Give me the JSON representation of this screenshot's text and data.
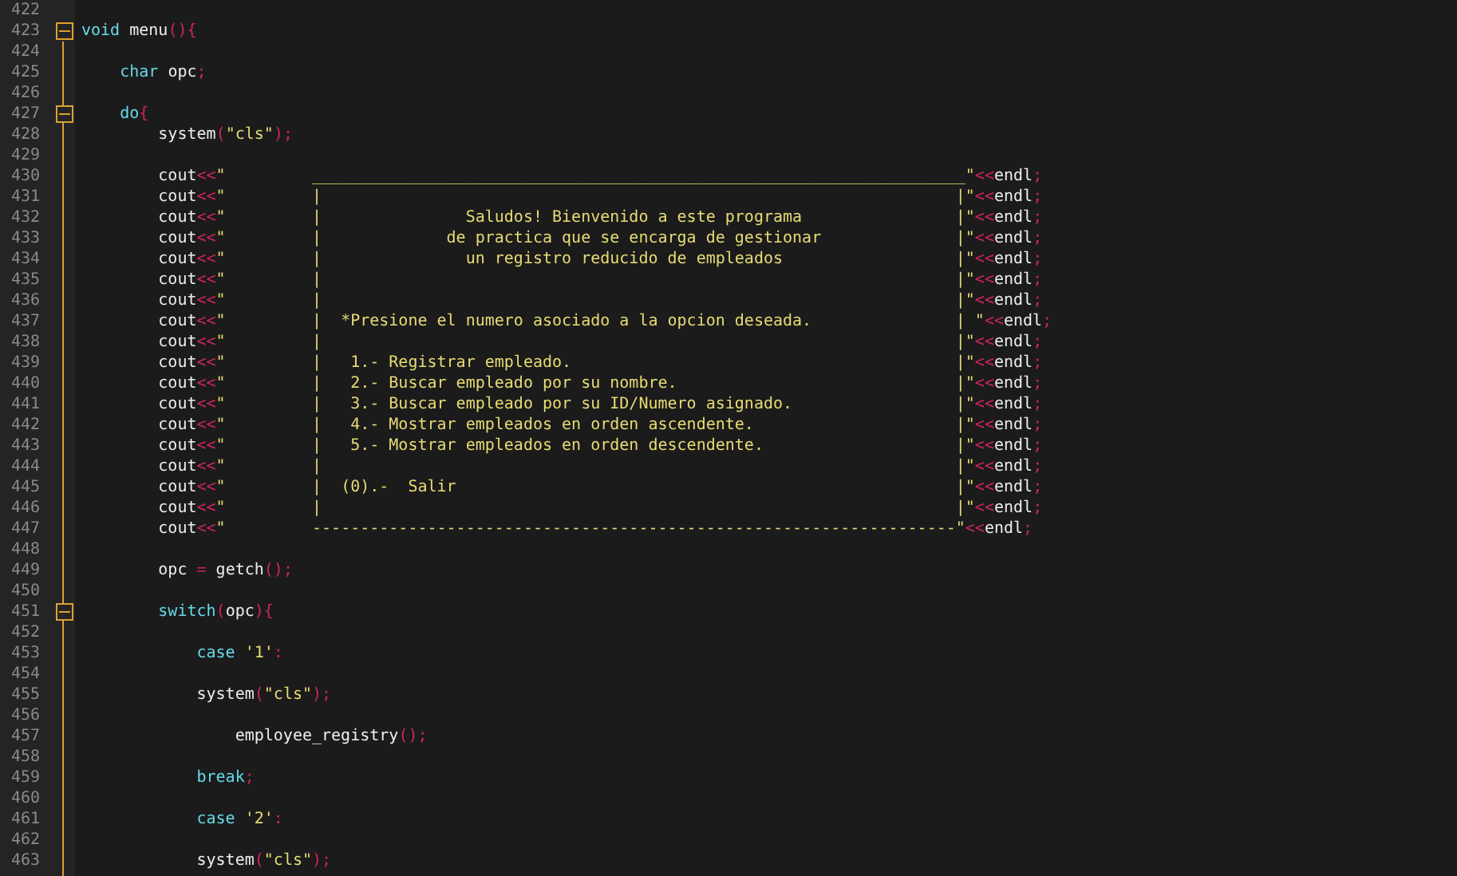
{
  "editor": {
    "lines": [
      {
        "number": "422",
        "fold_marker": false
      },
      {
        "number": "423",
        "fold_marker": true,
        "tokens": [
          {
            "kind": "keyword",
            "text": "void"
          },
          {
            "kind": "plain",
            "text": " menu"
          },
          {
            "kind": "punct",
            "text": "(){"
          }
        ]
      },
      {
        "number": "424",
        "fold_marker": false
      },
      {
        "number": "425",
        "fold_marker": false,
        "tokens": [
          {
            "kind": "keyword",
            "text": "    char"
          },
          {
            "kind": "plain",
            "text": " opc"
          },
          {
            "kind": "punct",
            "text": ";"
          }
        ]
      },
      {
        "number": "426",
        "fold_marker": false
      },
      {
        "number": "427",
        "fold_marker": true,
        "tokens": [
          {
            "kind": "keyword",
            "text": "    do"
          },
          {
            "kind": "punct",
            "text": "{"
          }
        ]
      },
      {
        "number": "428",
        "fold_marker": false,
        "tokens": [
          {
            "kind": "plain",
            "text": "        system"
          },
          {
            "kind": "punct",
            "text": "("
          },
          {
            "kind": "string",
            "text": "\"cls\""
          },
          {
            "kind": "punct",
            "text": ");"
          }
        ]
      },
      {
        "number": "429",
        "fold_marker": false
      },
      {
        "number": "430",
        "fold_marker": false,
        "tokens": [
          {
            "kind": "plain",
            "text": "        cout"
          },
          {
            "kind": "punct",
            "text": "<<"
          },
          {
            "kind": "string",
            "text": "\"         ____________________________________________________________________\""
          },
          {
            "kind": "punct",
            "text": "<<"
          },
          {
            "kind": "plain",
            "text": "endl"
          },
          {
            "kind": "punct",
            "text": ";"
          }
        ]
      },
      {
        "number": "431",
        "fold_marker": false,
        "tokens": [
          {
            "kind": "plain",
            "text": "        cout"
          },
          {
            "kind": "punct",
            "text": "<<"
          },
          {
            "kind": "string",
            "text": "\"         |                                                                  |\""
          },
          {
            "kind": "punct",
            "text": "<<"
          },
          {
            "kind": "plain",
            "text": "endl"
          },
          {
            "kind": "punct",
            "text": ";"
          }
        ]
      },
      {
        "number": "432",
        "fold_marker": false,
        "tokens": [
          {
            "kind": "plain",
            "text": "        cout"
          },
          {
            "kind": "punct",
            "text": "<<"
          },
          {
            "kind": "string",
            "text": "\"         |               Saludos! Bienvenido a este programa                |\""
          },
          {
            "kind": "punct",
            "text": "<<"
          },
          {
            "kind": "plain",
            "text": "endl"
          },
          {
            "kind": "punct",
            "text": ";"
          }
        ]
      },
      {
        "number": "433",
        "fold_marker": false,
        "tokens": [
          {
            "kind": "plain",
            "text": "        cout"
          },
          {
            "kind": "punct",
            "text": "<<"
          },
          {
            "kind": "string",
            "text": "\"         |             de practica que se encarga de gestionar              |\""
          },
          {
            "kind": "punct",
            "text": "<<"
          },
          {
            "kind": "plain",
            "text": "endl"
          },
          {
            "kind": "punct",
            "text": ";"
          }
        ]
      },
      {
        "number": "434",
        "fold_marker": false,
        "tokens": [
          {
            "kind": "plain",
            "text": "        cout"
          },
          {
            "kind": "punct",
            "text": "<<"
          },
          {
            "kind": "string",
            "text": "\"         |               un registro reducido de empleados                  |\""
          },
          {
            "kind": "punct",
            "text": "<<"
          },
          {
            "kind": "plain",
            "text": "endl"
          },
          {
            "kind": "punct",
            "text": ";"
          }
        ]
      },
      {
        "number": "435",
        "fold_marker": false,
        "tokens": [
          {
            "kind": "plain",
            "text": "        cout"
          },
          {
            "kind": "punct",
            "text": "<<"
          },
          {
            "kind": "string",
            "text": "\"         |                                                                  |\""
          },
          {
            "kind": "punct",
            "text": "<<"
          },
          {
            "kind": "plain",
            "text": "endl"
          },
          {
            "kind": "punct",
            "text": ";"
          }
        ]
      },
      {
        "number": "436",
        "fold_marker": false,
        "tokens": [
          {
            "kind": "plain",
            "text": "        cout"
          },
          {
            "kind": "punct",
            "text": "<<"
          },
          {
            "kind": "string",
            "text": "\"         |                                                                  |\""
          },
          {
            "kind": "punct",
            "text": "<<"
          },
          {
            "kind": "plain",
            "text": "endl"
          },
          {
            "kind": "punct",
            "text": ";"
          }
        ]
      },
      {
        "number": "437",
        "fold_marker": false,
        "tokens": [
          {
            "kind": "plain",
            "text": "        cout"
          },
          {
            "kind": "punct",
            "text": "<<"
          },
          {
            "kind": "string",
            "text": "\"         |  *Presione el numero asociado a la opcion deseada.               | \""
          },
          {
            "kind": "punct",
            "text": "<<"
          },
          {
            "kind": "plain",
            "text": "endl"
          },
          {
            "kind": "punct",
            "text": ";"
          }
        ]
      },
      {
        "number": "438",
        "fold_marker": false,
        "tokens": [
          {
            "kind": "plain",
            "text": "        cout"
          },
          {
            "kind": "punct",
            "text": "<<"
          },
          {
            "kind": "string",
            "text": "\"         |                                                                  |\""
          },
          {
            "kind": "punct",
            "text": "<<"
          },
          {
            "kind": "plain",
            "text": "endl"
          },
          {
            "kind": "punct",
            "text": ";"
          }
        ]
      },
      {
        "number": "439",
        "fold_marker": false,
        "tokens": [
          {
            "kind": "plain",
            "text": "        cout"
          },
          {
            "kind": "punct",
            "text": "<<"
          },
          {
            "kind": "string",
            "text": "\"         |   1.- Registrar empleado.                                        |\""
          },
          {
            "kind": "punct",
            "text": "<<"
          },
          {
            "kind": "plain",
            "text": "endl"
          },
          {
            "kind": "punct",
            "text": ";"
          }
        ]
      },
      {
        "number": "440",
        "fold_marker": false,
        "tokens": [
          {
            "kind": "plain",
            "text": "        cout"
          },
          {
            "kind": "punct",
            "text": "<<"
          },
          {
            "kind": "string",
            "text": "\"         |   2.- Buscar empleado por su nombre.                             |\""
          },
          {
            "kind": "punct",
            "text": "<<"
          },
          {
            "kind": "plain",
            "text": "endl"
          },
          {
            "kind": "punct",
            "text": ";"
          }
        ]
      },
      {
        "number": "441",
        "fold_marker": false,
        "tokens": [
          {
            "kind": "plain",
            "text": "        cout"
          },
          {
            "kind": "punct",
            "text": "<<"
          },
          {
            "kind": "string",
            "text": "\"         |   3.- Buscar empleado por su ID/Numero asignado.                 |\""
          },
          {
            "kind": "punct",
            "text": "<<"
          },
          {
            "kind": "plain",
            "text": "endl"
          },
          {
            "kind": "punct",
            "text": ";"
          }
        ]
      },
      {
        "number": "442",
        "fold_marker": false,
        "tokens": [
          {
            "kind": "plain",
            "text": "        cout"
          },
          {
            "kind": "punct",
            "text": "<<"
          },
          {
            "kind": "string",
            "text": "\"         |   4.- Mostrar empleados en orden ascendente.                     |\""
          },
          {
            "kind": "punct",
            "text": "<<"
          },
          {
            "kind": "plain",
            "text": "endl"
          },
          {
            "kind": "punct",
            "text": ";"
          }
        ]
      },
      {
        "number": "443",
        "fold_marker": false,
        "tokens": [
          {
            "kind": "plain",
            "text": "        cout"
          },
          {
            "kind": "punct",
            "text": "<<"
          },
          {
            "kind": "string",
            "text": "\"         |   5.- Mostrar empleados en orden descendente.                    |\""
          },
          {
            "kind": "punct",
            "text": "<<"
          },
          {
            "kind": "plain",
            "text": "endl"
          },
          {
            "kind": "punct",
            "text": ";"
          }
        ]
      },
      {
        "number": "444",
        "fold_marker": false,
        "tokens": [
          {
            "kind": "plain",
            "text": "        cout"
          },
          {
            "kind": "punct",
            "text": "<<"
          },
          {
            "kind": "string",
            "text": "\"         |                                                                  |\""
          },
          {
            "kind": "punct",
            "text": "<<"
          },
          {
            "kind": "plain",
            "text": "endl"
          },
          {
            "kind": "punct",
            "text": ";"
          }
        ]
      },
      {
        "number": "445",
        "fold_marker": false,
        "tokens": [
          {
            "kind": "plain",
            "text": "        cout"
          },
          {
            "kind": "punct",
            "text": "<<"
          },
          {
            "kind": "string",
            "text": "\"         |  (0).-  Salir                                                    |\""
          },
          {
            "kind": "punct",
            "text": "<<"
          },
          {
            "kind": "plain",
            "text": "endl"
          },
          {
            "kind": "punct",
            "text": ";"
          }
        ]
      },
      {
        "number": "446",
        "fold_marker": false,
        "tokens": [
          {
            "kind": "plain",
            "text": "        cout"
          },
          {
            "kind": "punct",
            "text": "<<"
          },
          {
            "kind": "string",
            "text": "\"         |                                                                  |\""
          },
          {
            "kind": "punct",
            "text": "<<"
          },
          {
            "kind": "plain",
            "text": "endl"
          },
          {
            "kind": "punct",
            "text": ";"
          }
        ]
      },
      {
        "number": "447",
        "fold_marker": false,
        "tokens": [
          {
            "kind": "plain",
            "text": "        cout"
          },
          {
            "kind": "punct",
            "text": "<<"
          },
          {
            "kind": "string",
            "text": "\"         -------------------------------------------------------------------\""
          },
          {
            "kind": "punct",
            "text": "<<"
          },
          {
            "kind": "plain",
            "text": "endl"
          },
          {
            "kind": "punct",
            "text": ";"
          }
        ]
      },
      {
        "number": "448",
        "fold_marker": false
      },
      {
        "number": "449",
        "fold_marker": false,
        "tokens": [
          {
            "kind": "plain",
            "text": "        opc "
          },
          {
            "kind": "punct",
            "text": "="
          },
          {
            "kind": "plain",
            "text": " getch"
          },
          {
            "kind": "punct",
            "text": "();"
          }
        ]
      },
      {
        "number": "450",
        "fold_marker": false
      },
      {
        "number": "451",
        "fold_marker": true,
        "tokens": [
          {
            "kind": "keyword",
            "text": "        switch"
          },
          {
            "kind": "punct",
            "text": "("
          },
          {
            "kind": "plain",
            "text": "opc"
          },
          {
            "kind": "punct",
            "text": "){"
          }
        ]
      },
      {
        "number": "452",
        "fold_marker": false
      },
      {
        "number": "453",
        "fold_marker": false,
        "tokens": [
          {
            "kind": "keyword",
            "text": "            case"
          },
          {
            "kind": "string",
            "text": " '1'"
          },
          {
            "kind": "punct",
            "text": ":"
          }
        ]
      },
      {
        "number": "454",
        "fold_marker": false
      },
      {
        "number": "455",
        "fold_marker": false,
        "tokens": [
          {
            "kind": "plain",
            "text": "            system"
          },
          {
            "kind": "punct",
            "text": "("
          },
          {
            "kind": "string",
            "text": "\"cls\""
          },
          {
            "kind": "punct",
            "text": ");"
          }
        ]
      },
      {
        "number": "456",
        "fold_marker": false
      },
      {
        "number": "457",
        "fold_marker": false,
        "tokens": [
          {
            "kind": "plain",
            "text": "                employee_registry"
          },
          {
            "kind": "punct",
            "text": "();"
          }
        ]
      },
      {
        "number": "458",
        "fold_marker": false
      },
      {
        "number": "459",
        "fold_marker": false,
        "tokens": [
          {
            "kind": "keyword",
            "text": "            break"
          },
          {
            "kind": "punct",
            "text": ";"
          }
        ]
      },
      {
        "number": "460",
        "fold_marker": false
      },
      {
        "number": "461",
        "fold_marker": false,
        "tokens": [
          {
            "kind": "keyword",
            "text": "            case"
          },
          {
            "kind": "string",
            "text": " '2'"
          },
          {
            "kind": "punct",
            "text": ":"
          }
        ]
      },
      {
        "number": "462",
        "fold_marker": false
      },
      {
        "number": "463",
        "fold_marker": false,
        "tokens": [
          {
            "kind": "plain",
            "text": "            system"
          },
          {
            "kind": "punct",
            "text": "("
          },
          {
            "kind": "string",
            "text": "\"cls\""
          },
          {
            "kind": "punct",
            "text": ");"
          }
        ]
      }
    ]
  }
}
